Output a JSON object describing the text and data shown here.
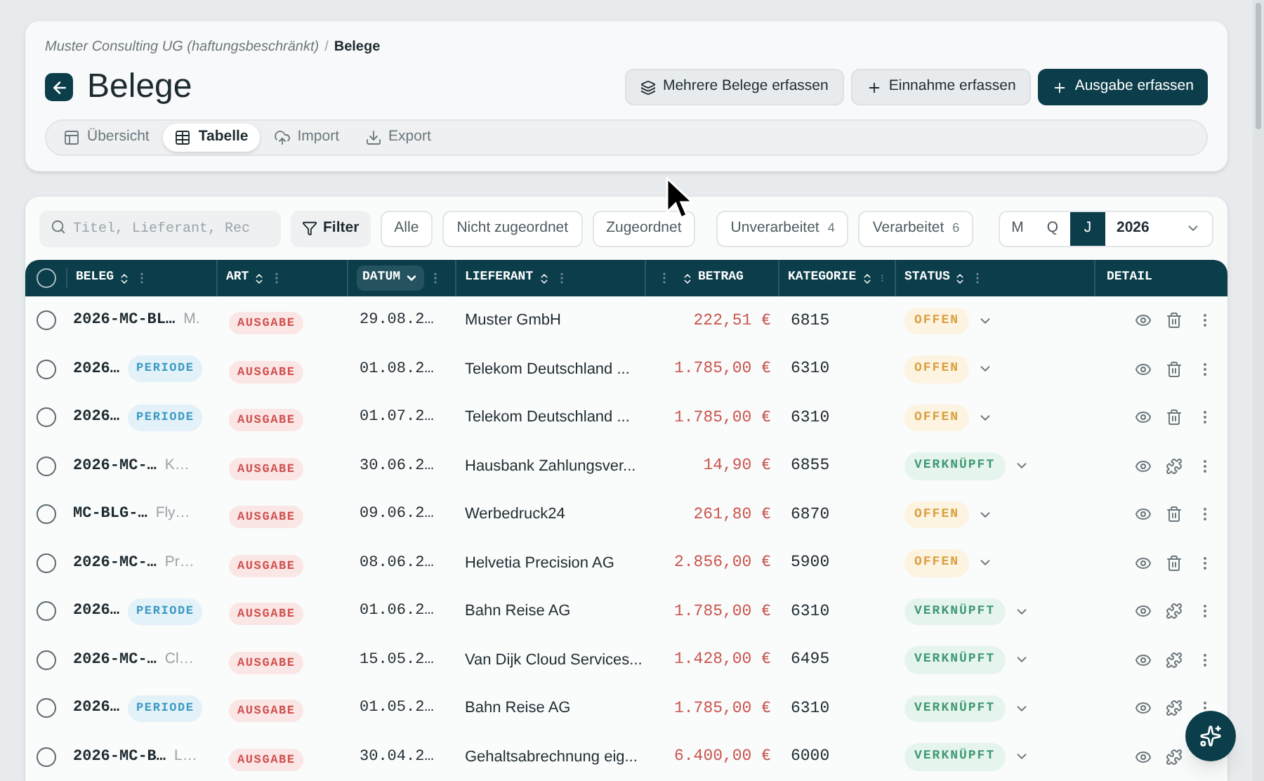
{
  "breadcrumb": {
    "parent": "Muster Consulting UG (haftungsbeschränkt)",
    "separator": "/",
    "current": "Belege"
  },
  "title": "Belege",
  "actions": [
    {
      "label": "Mehrere Belege erfassen",
      "kind": "layers"
    },
    {
      "label": "Einnahme erfassen",
      "kind": "secondary"
    },
    {
      "label": "Ausgabe erfassen",
      "kind": "primary"
    }
  ],
  "view_tabs": [
    {
      "label": "Übersicht",
      "kind": "overview",
      "selected": false
    },
    {
      "label": "Tabelle",
      "kind": "table",
      "selected": true
    },
    {
      "label": "Import",
      "kind": "import",
      "selected": false
    },
    {
      "label": "Export",
      "kind": "export",
      "selected": false
    }
  ],
  "search": {
    "placeholder": "Titel, Lieferant, Rec"
  },
  "filter_button": "Filter",
  "filters": [
    {
      "label": "Alle"
    },
    {
      "label": "Nicht zugeordnet"
    },
    {
      "label": "Zugeordnet"
    },
    {
      "label": "Unverarbeitet",
      "count": "4"
    },
    {
      "label": "Verarbeitet",
      "count": "6"
    }
  ],
  "period": {
    "options": [
      {
        "label": "M",
        "selected": false
      },
      {
        "label": "Q",
        "selected": false
      },
      {
        "label": "J",
        "selected": true
      }
    ],
    "year": "2026"
  },
  "table": {
    "select_all_checked": false,
    "columns": [
      {
        "label": "BELEG",
        "kind": "sortable"
      },
      {
        "label": "ART",
        "kind": "sortable"
      },
      {
        "label": "DATUM",
        "kind": "sorted"
      },
      {
        "label": "LIEFERANT",
        "kind": "sortable"
      },
      {
        "label": "BETRAG",
        "kind": "sortable"
      },
      {
        "label": "KATEGORIE",
        "kind": "sortable"
      },
      {
        "label": "STATUS",
        "kind": "sortable"
      },
      {
        "label": "DETAIL",
        "kind": "plain"
      }
    ],
    "rows": [
      {
        "checked": false,
        "beleg": "2026-MC-BL…",
        "tag": {
          "kind": "text",
          "label": "M."
        },
        "art": "AUSGABE",
        "datum": "29.08.2…",
        "lieferant": "Muster GmbH",
        "betrag": "222,51 €",
        "kategorie": "6815",
        "status": {
          "kind": "offen",
          "label": "OFFEN"
        }
      },
      {
        "checked": false,
        "beleg": "2026…",
        "tag": {
          "kind": "periode",
          "label": "PERIODE"
        },
        "art": "AUSGABE",
        "datum": "01.08.2…",
        "lieferant": "Telekom Deutschland ...",
        "betrag": "1.785,00 €",
        "kategorie": "6310",
        "status": {
          "kind": "offen",
          "label": "OFFEN"
        }
      },
      {
        "checked": false,
        "beleg": "2026…",
        "tag": {
          "kind": "periode",
          "label": "PERIODE"
        },
        "art": "AUSGABE",
        "datum": "01.07.2…",
        "lieferant": "Telekom Deutschland ...",
        "betrag": "1.785,00 €",
        "kategorie": "6310",
        "status": {
          "kind": "offen",
          "label": "OFFEN"
        }
      },
      {
        "checked": false,
        "beleg": "2026-MC-…",
        "tag": {
          "kind": "text",
          "label": "K…"
        },
        "art": "AUSGABE",
        "datum": "30.06.2…",
        "lieferant": "Hausbank Zahlungsver...",
        "betrag": "14,90 €",
        "kategorie": "6855",
        "status": {
          "kind": "verknuepft",
          "label": "VERKNÜPFT"
        }
      },
      {
        "checked": false,
        "beleg": "MC-BLG-…",
        "tag": {
          "kind": "text",
          "label": "Fly…"
        },
        "art": "AUSGABE",
        "datum": "09.06.2…",
        "lieferant": "Werbedruck24",
        "betrag": "261,80 €",
        "kategorie": "6870",
        "status": {
          "kind": "offen",
          "label": "OFFEN"
        }
      },
      {
        "checked": false,
        "beleg": "2026-MC-…",
        "tag": {
          "kind": "text",
          "label": "Pr…"
        },
        "art": "AUSGABE",
        "datum": "08.06.2…",
        "lieferant": "Helvetia Precision AG",
        "betrag": "2.856,00 €",
        "kategorie": "5900",
        "status": {
          "kind": "offen",
          "label": "OFFEN"
        }
      },
      {
        "checked": false,
        "beleg": "2026…",
        "tag": {
          "kind": "periode",
          "label": "PERIODE"
        },
        "art": "AUSGABE",
        "datum": "01.06.2…",
        "lieferant": "Bahn Reise AG",
        "betrag": "1.785,00 €",
        "kategorie": "6310",
        "status": {
          "kind": "verknuepft",
          "label": "VERKNÜPFT"
        }
      },
      {
        "checked": false,
        "beleg": "2026-MC-…",
        "tag": {
          "kind": "text",
          "label": "Cl…"
        },
        "art": "AUSGABE",
        "datum": "15.05.2…",
        "lieferant": "Van Dijk Cloud Services...",
        "betrag": "1.428,00 €",
        "kategorie": "6495",
        "status": {
          "kind": "verknuepft",
          "label": "VERKNÜPFT"
        }
      },
      {
        "checked": false,
        "beleg": "2026…",
        "tag": {
          "kind": "periode",
          "label": "PERIODE"
        },
        "art": "AUSGABE",
        "datum": "01.05.2…",
        "lieferant": "Bahn Reise AG",
        "betrag": "1.785,00 €",
        "kategorie": "6310",
        "status": {
          "kind": "verknuepft",
          "label": "VERKNÜPFT"
        }
      },
      {
        "checked": false,
        "beleg": "2026-MC-B…",
        "tag": {
          "kind": "text",
          "label": "L…"
        },
        "art": "AUSGABE",
        "datum": "30.04.2…",
        "lieferant": "Gehaltsabrechnung eig...",
        "betrag": "6.400,00 €",
        "kategorie": "6000",
        "status": {
          "kind": "verknuepft",
          "label": "VERKNÜPFT"
        }
      }
    ]
  }
}
